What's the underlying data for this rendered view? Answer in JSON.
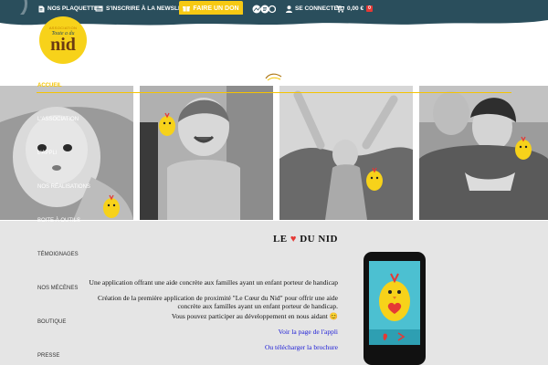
{
  "topbar": {
    "plaquettes": "NOS PLAQUETTES",
    "newsletter": "S'INSCRIRE À LA NEWSLETTER",
    "donate": "FAIRE UN DON",
    "login": "SE CONNECTER",
    "cart_total": "0,00 €",
    "cart_count": "0"
  },
  "logo": {
    "line1": "ASSOCIATION",
    "line2": "Toute a du",
    "line3": "nid"
  },
  "menu": [
    {
      "label": "ACCUEIL",
      "active": true
    },
    {
      "label": "L'ASSOCIATION",
      "active": false
    },
    {
      "label": "L'APPLI",
      "active": false
    },
    {
      "label": "NOS RÉALISATIONS",
      "active": false
    },
    {
      "label": "BOITE À OUTILS",
      "active": false
    },
    {
      "label": "TÉMOIGNAGES",
      "active": false
    },
    {
      "label": "NOS MÉCÈNES",
      "active": false
    },
    {
      "label": "BOUTIQUE",
      "active": false
    },
    {
      "label": "PRESSE",
      "active": false
    }
  ],
  "content": {
    "title_left": "LE",
    "title_right": "DU NID",
    "line1": "Une application offrant une aide concrète aux familles ayant un enfant porteur de handicap",
    "line2": "Création de la première application de proximité \"Le Cœur du Nid\" pour offrir une aide",
    "line3": "concrète aux familles ayant un enfant porteur de handicap.",
    "line4": "Vous pouvez participer au développement en nous aidant 😊",
    "link_app": "Voir la page de l'appli",
    "link_brochure": "Ou télécharger la brochure"
  },
  "colors": {
    "topbar": "#2a4e5c",
    "accent": "#f6c913",
    "heart": "#e53935",
    "link": "#1a1ad6"
  },
  "icons": [
    "document-icon",
    "newsletter-icon",
    "gift-icon",
    "social-icon",
    "user-icon",
    "cart-icon",
    "heart-icon",
    "bird-icon"
  ]
}
